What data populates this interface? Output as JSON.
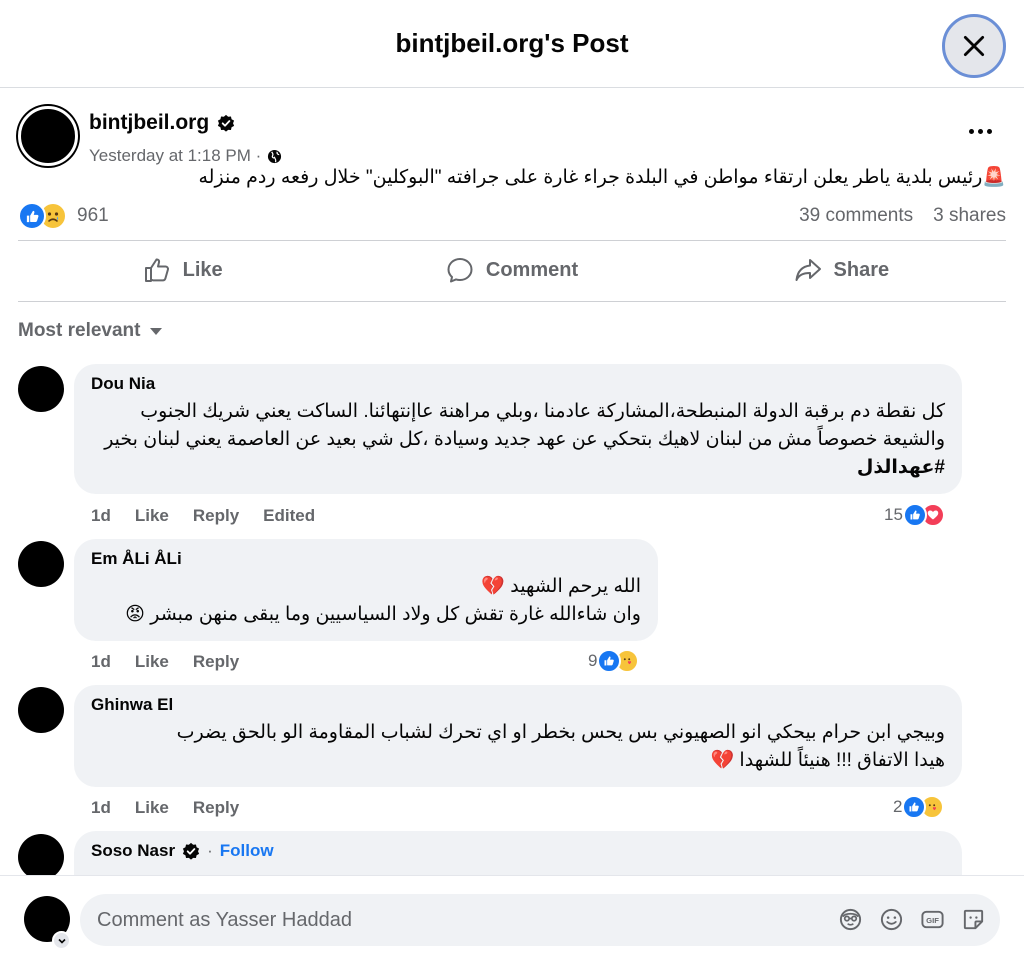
{
  "header": {
    "title": "bintjbeil.org's Post"
  },
  "post": {
    "author": "bintjbeil.org",
    "time": "Yesterday at 1:18 PM ·",
    "text": "🚨رئيس بلدية ياطر يعلن ارتقاء مواطن في البلدة جراء غارة على جرافته \"البوكلين\" خلال رفعه ردم منزله",
    "reaction_count": "961",
    "comments_count": "39 comments",
    "shares_count": "3 shares"
  },
  "actions": {
    "like": "Like",
    "comment": "Comment",
    "share": "Share"
  },
  "sort_label": "Most relevant",
  "comments": [
    {
      "name": "Dou Nia",
      "text": "كل نقطة دم برقبة الدولة المنبطحة،المشاركة عادمنا ،وبلي مراهنة عاإنتهائنا. الساكت يعني شريك الجنوب والشيعة خصوصاً مش من لبنان لاهيك بتحكي عن عهد جديد وسيادة ،كل شي بعيد عن العاصمة يعني لبنان بخير",
      "hashtag": "#عهدالذل",
      "age": "1d",
      "like": "Like",
      "reply": "Reply",
      "edited": "Edited",
      "reactions": "15"
    },
    {
      "name": "Em ÅLi ÅLi",
      "line1": "الله يرحم الشهيد 💔",
      "line2": "وان شاءالله غارة تقش كل ولاد السياسيين وما يبقى منهن مبشر 😡",
      "age": "1d",
      "like": "Like",
      "reply": "Reply",
      "reactions": "9"
    },
    {
      "name": "Ghinwa El",
      "line1": "وبيجي ابن حرام بيحكي انو الصهيوني بس يحس بخطر او اي تحرك لشباب المقاومة الو بالحق يضرب",
      "line2": "هيدا الاتفاق !!! هنيئاً للشهدا 💔",
      "age": "1d",
      "like": "Like",
      "reply": "Reply",
      "reactions": "2"
    },
    {
      "name": "Soso Nasr",
      "separator": "·",
      "follow": "Follow"
    }
  ],
  "composer": {
    "placeholder": "Comment as Yasser Haddad"
  },
  "icons": {
    "close": "close-icon",
    "verified": "verified-badge-icon",
    "globe": "globe-icon",
    "more": "more-options-icon",
    "like": "thumbs-up-icon",
    "comment": "comment-bubble-icon",
    "share": "share-arrow-icon",
    "avatar_sticker": "avatar-sticker-icon",
    "emoji": "emoji-icon",
    "gif": "gif-icon",
    "sticker": "sticker-icon"
  },
  "colors": {
    "accent": "#1877f2",
    "muted": "#65676b",
    "bubble": "#f0f2f5",
    "love": "#f33e58",
    "care": "#f7c43b"
  }
}
